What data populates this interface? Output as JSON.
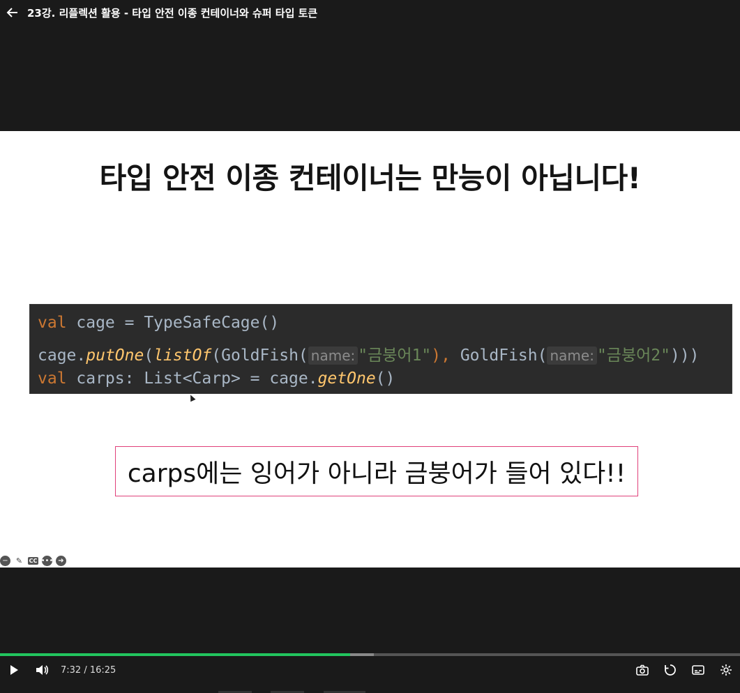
{
  "header": {
    "back_icon": "arrow-left-icon",
    "title": "23강. 리플렉션 활용 - 타입 안전 이종 컨테이너와 슈퍼 타입 토큰"
  },
  "slide": {
    "heading": "타입 안전 이종 컨테이너는 만능이 아닙니다!",
    "code": {
      "line1": {
        "kw": "val",
        "rest": " cage = TypeSafeCage()"
      },
      "line2": {
        "obj": "cage.",
        "fn1": "putOne",
        "p1": "(",
        "fn2": "listOf",
        "p2": "(GoldFish(",
        "hint1": "name:",
        "str1": "\"금붕어1\"",
        "comma": "),",
        "p3": " GoldFish(",
        "hint2": "name:",
        "str2": "\"금붕어2\"",
        "end": ")))"
      },
      "line3": {
        "kw": "val",
        "mid": " carps: List<Carp> = cage.",
        "fn": "getOne",
        "end": "()"
      }
    },
    "note": "carps에는 잉어가 아니라 금붕어가 들어 있다!!",
    "note_border_color": "#e0407a",
    "tools": [
      "minus-circle-icon",
      "pencil-icon",
      "cc-icon",
      "more-icon",
      "arrow-right-circle-icon"
    ]
  },
  "player": {
    "time": "7:32 / 16:25",
    "progress_played": 0.473,
    "progress_buffered": 0.505,
    "accent": "#22c55e",
    "icons": [
      "play-icon",
      "volume-icon",
      "camera-icon",
      "replay-icon",
      "subtitles-icon",
      "settings-icon"
    ]
  }
}
